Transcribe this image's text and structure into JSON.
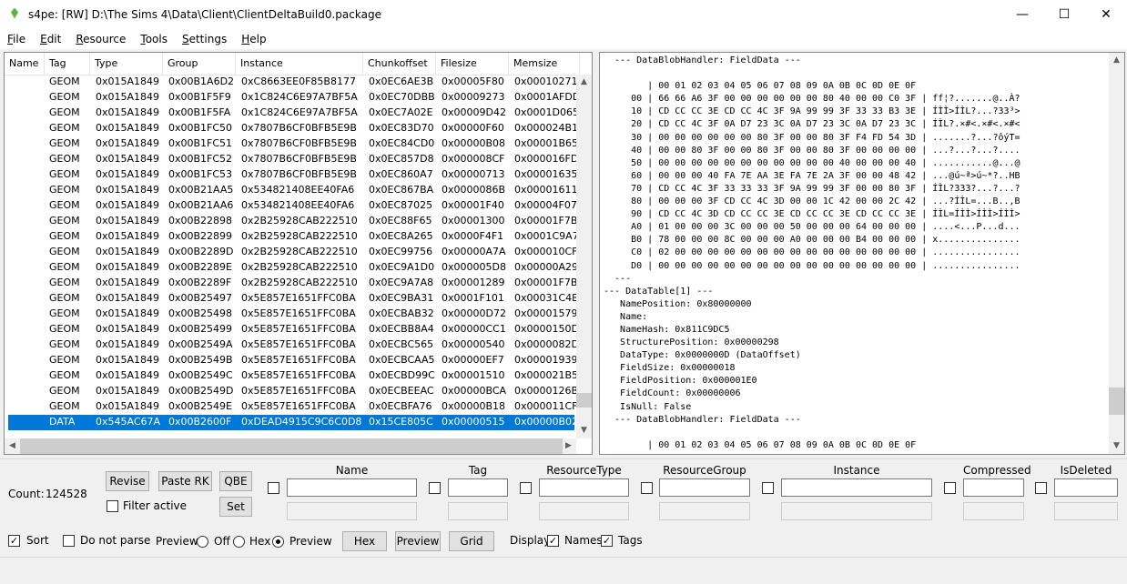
{
  "window": {
    "title": "s4pe: [RW] D:\\The Sims 4\\Data\\Client\\ClientDeltaBuild0.package",
    "minimize": "—",
    "maximize": "☐",
    "close": "✕"
  },
  "menu": [
    {
      "label": "File",
      "ul": "F",
      "rest": "ile"
    },
    {
      "label": "Edit",
      "ul": "E",
      "rest": "dit"
    },
    {
      "label": "Resource",
      "ul": "R",
      "rest": "esource"
    },
    {
      "label": "Tools",
      "ul": "T",
      "rest": "ools"
    },
    {
      "label": "Settings",
      "ul": "S",
      "rest": "ettings"
    },
    {
      "label": "Help",
      "ul": "H",
      "rest": "elp"
    }
  ],
  "list": {
    "columns": [
      "Name",
      "Tag",
      "Type",
      "Group",
      "Instance",
      "Chunkoffset",
      "Filesize",
      "Memsize"
    ],
    "rows": [
      [
        "",
        "GEOM",
        "0x015A1849",
        "0x00B1A6D2",
        "0xC8663EE0F85B8177",
        "0x0EC6AE3B",
        "0x00005F80",
        "0x00010271"
      ],
      [
        "",
        "GEOM",
        "0x015A1849",
        "0x00B1F5F9",
        "0x1C824C6E97A7BF5A",
        "0x0EC70DBB",
        "0x00009273",
        "0x0001AFDD"
      ],
      [
        "",
        "GEOM",
        "0x015A1849",
        "0x00B1F5FA",
        "0x1C824C6E97A7BF5A",
        "0x0EC7A02E",
        "0x00009D42",
        "0x0001D065"
      ],
      [
        "",
        "GEOM",
        "0x015A1849",
        "0x00B1FC50",
        "0x7807B6CF0BFB5E9B",
        "0x0EC83D70",
        "0x00000F60",
        "0x000024B1"
      ],
      [
        "",
        "GEOM",
        "0x015A1849",
        "0x00B1FC51",
        "0x7807B6CF0BFB5E9B",
        "0x0EC84CD0",
        "0x00000B08",
        "0x00001B65"
      ],
      [
        "",
        "GEOM",
        "0x015A1849",
        "0x00B1FC52",
        "0x7807B6CF0BFB5E9B",
        "0x0EC857D8",
        "0x000008CF",
        "0x000016FD"
      ],
      [
        "",
        "GEOM",
        "0x015A1849",
        "0x00B1FC53",
        "0x7807B6CF0BFB5E9B",
        "0x0EC860A7",
        "0x00000713",
        "0x00001635"
      ],
      [
        "",
        "GEOM",
        "0x015A1849",
        "0x00B21AA5",
        "0x534821408EE40FA6",
        "0x0EC867BA",
        "0x0000086B",
        "0x00001611"
      ],
      [
        "",
        "GEOM",
        "0x015A1849",
        "0x00B21AA6",
        "0x534821408EE40FA6",
        "0x0EC87025",
        "0x00001F40",
        "0x00004F07"
      ],
      [
        "",
        "GEOM",
        "0x015A1849",
        "0x00B22898",
        "0x2B25928CAB222510",
        "0x0EC88F65",
        "0x00001300",
        "0x00001F7B"
      ],
      [
        "",
        "GEOM",
        "0x015A1849",
        "0x00B22899",
        "0x2B25928CAB222510",
        "0x0EC8A265",
        "0x0000F4F1",
        "0x0001C9A7"
      ],
      [
        "",
        "GEOM",
        "0x015A1849",
        "0x00B2289D",
        "0x2B25928CAB222510",
        "0x0EC99756",
        "0x00000A7A",
        "0x000010CF"
      ],
      [
        "",
        "GEOM",
        "0x015A1849",
        "0x00B2289E",
        "0x2B25928CAB222510",
        "0x0EC9A1D0",
        "0x000005D8",
        "0x00000A29"
      ],
      [
        "",
        "GEOM",
        "0x015A1849",
        "0x00B2289F",
        "0x2B25928CAB222510",
        "0x0EC9A7A8",
        "0x00001289",
        "0x00001F7B"
      ],
      [
        "",
        "GEOM",
        "0x015A1849",
        "0x00B25497",
        "0x5E857E1651FFC0BA",
        "0x0EC9BA31",
        "0x0001F101",
        "0x00031C4B"
      ],
      [
        "",
        "GEOM",
        "0x015A1849",
        "0x00B25498",
        "0x5E857E1651FFC0BA",
        "0x0ECBAB32",
        "0x00000D72",
        "0x00001579"
      ],
      [
        "",
        "GEOM",
        "0x015A1849",
        "0x00B25499",
        "0x5E857E1651FFC0BA",
        "0x0ECBB8A4",
        "0x00000CC1",
        "0x0000150D"
      ],
      [
        "",
        "GEOM",
        "0x015A1849",
        "0x00B2549A",
        "0x5E857E1651FFC0BA",
        "0x0ECBC565",
        "0x00000540",
        "0x0000082D"
      ],
      [
        "",
        "GEOM",
        "0x015A1849",
        "0x00B2549B",
        "0x5E857E1651FFC0BA",
        "0x0ECBCAA5",
        "0x00000EF7",
        "0x00001939"
      ],
      [
        "",
        "GEOM",
        "0x015A1849",
        "0x00B2549C",
        "0x5E857E1651FFC0BA",
        "0x0ECBD99C",
        "0x00001510",
        "0x000021B5"
      ],
      [
        "",
        "GEOM",
        "0x015A1849",
        "0x00B2549D",
        "0x5E857E1651FFC0BA",
        "0x0ECBEEAC",
        "0x00000BCA",
        "0x0000126B"
      ],
      [
        "",
        "GEOM",
        "0x015A1849",
        "0x00B2549E",
        "0x5E857E1651FFC0BA",
        "0x0ECBFA76",
        "0x00000B18",
        "0x000011CF"
      ],
      [
        "",
        "DATA",
        "0x545AC67A",
        "0x00B2600F",
        "0xDEAD4915C9C6C0D8",
        "0x15CE805C",
        "0x00000515",
        "0x00000B02"
      ]
    ],
    "selected_index": 22
  },
  "preview": {
    "lines": [
      "  --- DataBlobHandler: FieldData ---",
      "",
      "        | 00 01 02 03 04 05 06 07 08 09 0A 0B 0C 0D 0E 0F",
      "     00 | 66 66 A6 3F 00 00 00 00 00 00 80 40 00 00 C0 3F | ff¦?.......@..À?",
      "     10 | CD CC CC 3E CD CC 4C 3F 9A 99 99 3F 33 33 B3 3E | ÍÌÌ>ÍÌL?...?33³>",
      "     20 | CD CC 4C 3F 0A D7 23 3C 0A D7 23 3C 0A D7 23 3C | ÍÌL?.×#<.×#<.×#<",
      "     30 | 00 00 00 00 00 00 80 3F 00 00 80 3F F4 FD 54 3D | .......?...?ôýT=",
      "     40 | 00 00 80 3F 00 00 80 3F 00 00 80 3F 00 00 00 00 | ...?...?...?....",
      "     50 | 00 00 00 00 00 00 00 00 00 00 00 40 00 00 00 40 | ...........@...@",
      "     60 | 00 00 00 40 FA 7E AA 3E FA 7E 2A 3F 00 00 48 42 | ...@ú~ª>ú~*?..HB",
      "     70 | CD CC 4C 3F 33 33 33 3F 9A 99 99 3F 00 00 80 3F | ÍÌL?333?...?...?",
      "     80 | 00 00 00 3F CD CC 4C 3D 00 00 1C 42 00 00 2C 42 | ...?ÍÌL=...B..,B",
      "     90 | CD CC 4C 3D CD CC CC 3E CD CC CC 3E CD CC CC 3E | ÍÌL=ÍÌÌ>ÍÌÌ>ÍÌÌ>",
      "     A0 | 01 00 00 00 3C 00 00 00 50 00 00 00 64 00 00 00 | ....<...P...d...",
      "     B0 | 78 00 00 00 8C 00 00 00 A0 00 00 00 B4 00 00 00 | x...............",
      "     C0 | 02 00 00 00 00 00 00 00 00 00 00 00 00 00 00 00 | ................",
      "     D0 | 00 00 00 00 00 00 00 00 00 00 00 00 00 00 00 00 | ................",
      "  ---",
      "--- DataTable[1] ---",
      "   NamePosition: 0x80000000",
      "   Name:",
      "   NameHash: 0x811C9DC5",
      "   StructurePosition: 0x00000298",
      "   DataType: 0x0000000D (DataOffset)",
      "   FieldSize: 0x00000018",
      "   FieldPosition: 0x000001E0",
      "   FieldCount: 0x00000006",
      "   IsNull: False",
      "  --- DataBlobHandler: FieldData ---",
      "",
      "        | 00 01 02 03 04 05 06 07 08 09 0A 0B 0C 0D 0E 0F"
    ]
  },
  "controls": {
    "count_label": "Count:",
    "count_value": "124528",
    "revise": "Revise",
    "paste_rk": "Paste RK",
    "qbe": "QBE",
    "filter_active": "Filter active",
    "set": "Set",
    "filter_columns": [
      "Name",
      "Tag",
      "ResourceType",
      "ResourceGroup",
      "Instance",
      "Compressed",
      "IsDeleted"
    ],
    "sort": "Sort",
    "do_not_parse": "Do not parse",
    "preview_label": "Preview:",
    "preview_off": "Off",
    "preview_hex": "Hex",
    "preview_preview": "Preview",
    "hex_button": "Hex",
    "preview_button": "Preview",
    "grid_button": "Grid",
    "display_label": "Display:",
    "names": "Names",
    "tags": "Tags"
  }
}
